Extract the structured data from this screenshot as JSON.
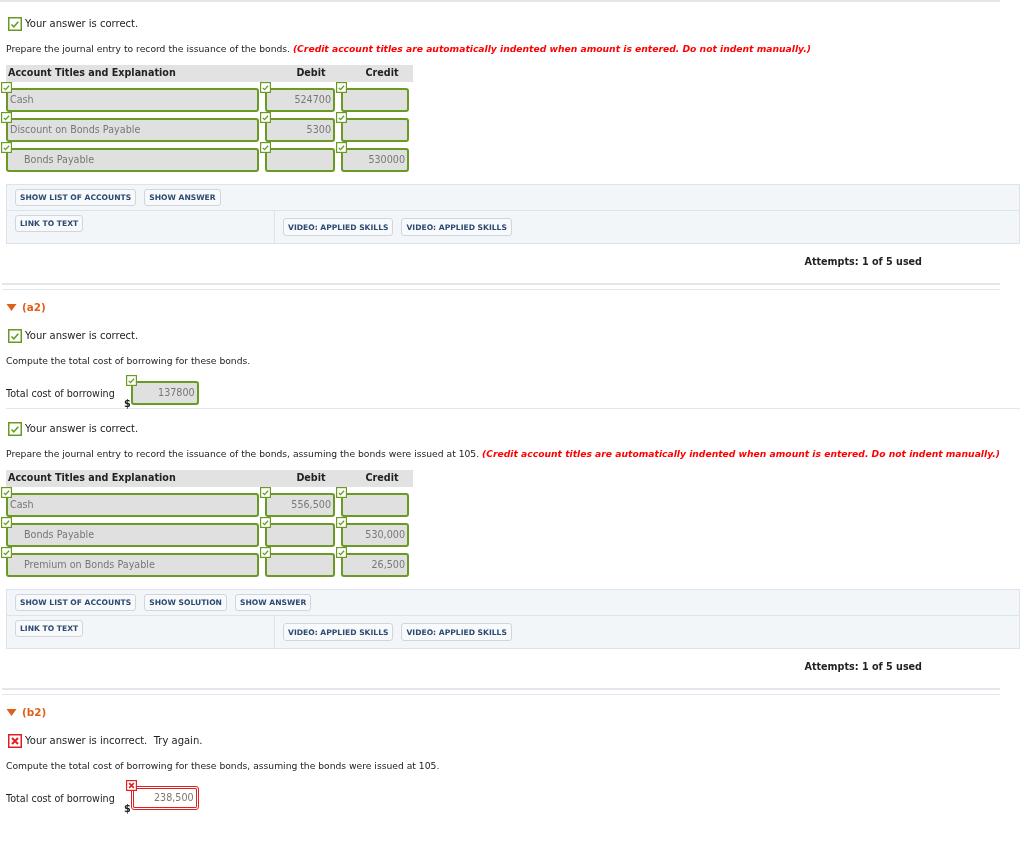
{
  "blocks": [
    {
      "kind": "result",
      "correct": true,
      "text": "Your answer is correct."
    },
    {
      "kind": "question",
      "text": "Prepare the journal entry to record the issuance of the bonds.",
      "note": "(Credit account titles are automatically indented when amount is entered. Do not indent manually.)"
    },
    {
      "kind": "journal",
      "columns": [
        "Account Titles and Explanation",
        "Debit",
        "Credit"
      ],
      "rows": [
        {
          "account": "Cash",
          "debit": "524700",
          "indented": false,
          "correct": true
        },
        {
          "account": "Discount on Bonds Payable",
          "debit": "5300",
          "indented": false,
          "correct": true
        },
        {
          "account": "Bonds Payable",
          "credit": "530000",
          "indented": true,
          "correct": true
        }
      ]
    },
    {
      "kind": "toolbar",
      "buttons": [
        "SHOW LIST OF ACCOUNTS",
        "SHOW ANSWER"
      ],
      "links": [
        "LINK TO TEXT"
      ],
      "videos": [
        "VIDEO: APPLIED SKILLS",
        "VIDEO: APPLIED SKILLS"
      ]
    },
    {
      "kind": "attempts",
      "text": "Attempts: 1 of 5 used"
    },
    {
      "kind": "part",
      "label": "(a2)",
      "expanded": true
    },
    {
      "kind": "result",
      "correct": true,
      "text": "Your answer is correct."
    },
    {
      "kind": "question",
      "text": "Compute the total cost of borrowing for these bonds."
    },
    {
      "kind": "amount",
      "label": "Total cost of borrowing",
      "currency": "$",
      "value": "137800",
      "correct": true
    },
    {
      "kind": "rule"
    },
    {
      "kind": "result",
      "correct": true,
      "text": "Your answer is correct."
    },
    {
      "kind": "question",
      "text": "Prepare the journal entry to record the issuance of the bonds, assuming the bonds were issued at 105.",
      "note": "(Credit account titles are automatically indented when amount is entered. Do not indent manually.)"
    },
    {
      "kind": "journal",
      "columns": [
        "Account Titles and Explanation",
        "Debit",
        "Credit"
      ],
      "rows": [
        {
          "account": "Cash",
          "debit": "556,500",
          "indented": false,
          "correct": true
        },
        {
          "account": "Bonds Payable",
          "credit": "530,000",
          "indented": true,
          "correct": true
        },
        {
          "account": "Premium on Bonds Payable",
          "credit": "26,500",
          "indented": true,
          "correct": true
        }
      ]
    },
    {
      "kind": "toolbar",
      "buttons": [
        "SHOW LIST OF ACCOUNTS",
        "SHOW SOLUTION",
        "SHOW ANSWER"
      ],
      "links": [
        "LINK TO TEXT"
      ],
      "videos": [
        "VIDEO: APPLIED SKILLS",
        "VIDEO: APPLIED SKILLS"
      ]
    },
    {
      "kind": "attempts",
      "text": "Attempts: 1 of 5 used"
    },
    {
      "kind": "part",
      "label": "(b2)",
      "expanded": true
    },
    {
      "kind": "result",
      "correct": false,
      "text": "Your answer is incorrect.  Try again."
    },
    {
      "kind": "question",
      "text": "Compute the total cost of borrowing for these bonds, assuming the bonds were issued at 105."
    },
    {
      "kind": "amount",
      "label": "Total cost of borrowing",
      "currency": "$",
      "value": "238,500",
      "correct": false
    }
  ]
}
